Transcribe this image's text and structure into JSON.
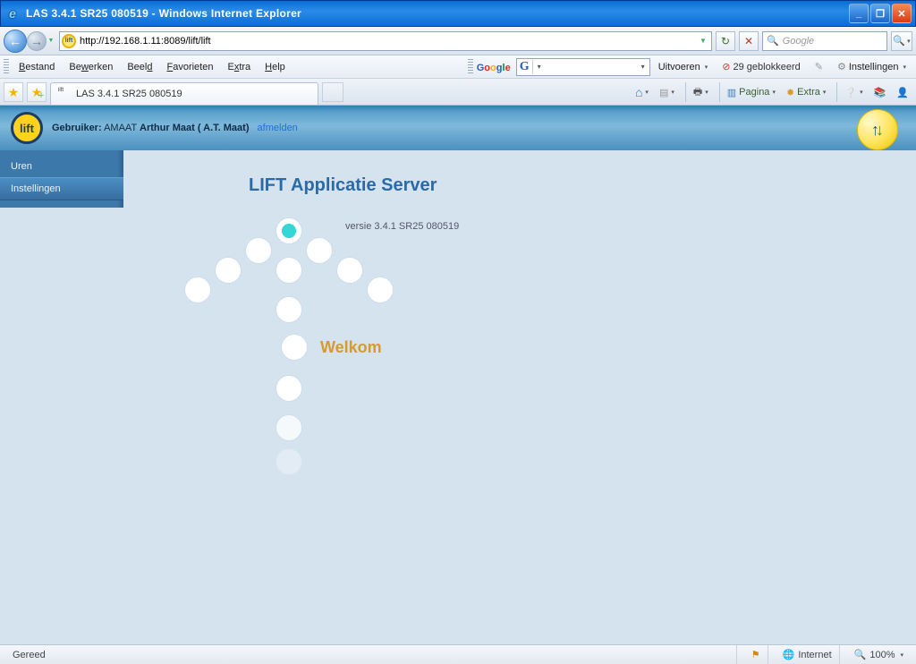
{
  "window": {
    "title": "LAS 3.4.1 SR25 080519 - Windows Internet Explorer"
  },
  "address": {
    "url": "http://192.168.1.11:8089/lift/lift",
    "search_placeholder": "Google"
  },
  "menu": {
    "items": [
      "Bestand",
      "Bewerken",
      "Beeld",
      "Favorieten",
      "Extra",
      "Help"
    ]
  },
  "google_toolbar": {
    "run_label": "Uitvoeren",
    "blocked_count": "29 geblokkeerd",
    "settings_label": "Instellingen"
  },
  "tabs": {
    "active_title": "LAS 3.4.1 SR25 080519"
  },
  "command_bar": {
    "page_label": "Pagina",
    "extra_label": "Extra"
  },
  "app_header": {
    "user_label": "Gebruiker:",
    "user_code": "AMAAT",
    "user_name": "Arthur Maat ( A.T. Maat)",
    "logout": "afmelden",
    "logo_text": "lift"
  },
  "sidebar": {
    "items": [
      "Uren",
      "Instellingen"
    ]
  },
  "page": {
    "title": "LIFT Applicatie Server",
    "version": "versie 3.4.1 SR25 080519",
    "welcome": "Welkom"
  },
  "status": {
    "ready": "Gereed",
    "zone": "Internet",
    "zoom": "100%"
  }
}
